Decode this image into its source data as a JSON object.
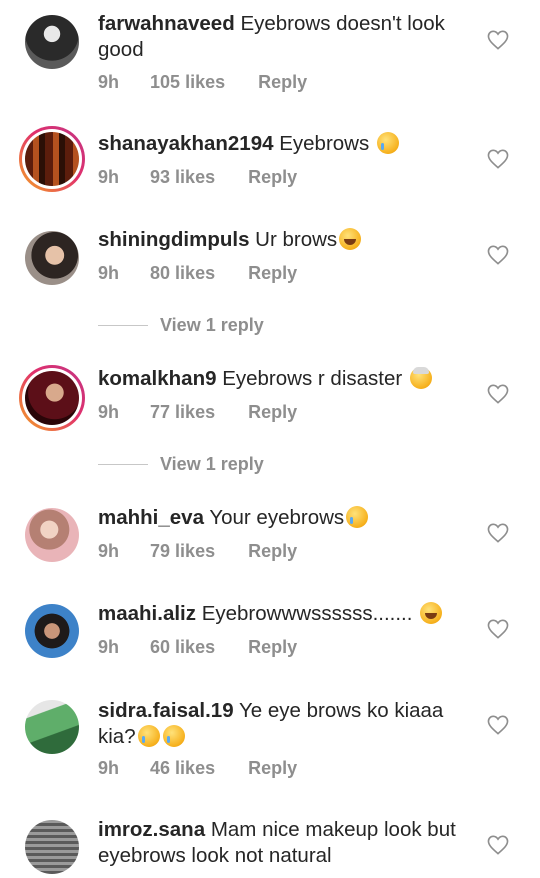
{
  "comments": [
    {
      "username": "farwahnaveed",
      "text": "Eyebrows doesn't look good",
      "time": "9h",
      "likes": "105 likes",
      "reply": "Reply",
      "avatar_color": "#4a4a4a"
    },
    {
      "username": "shanayakhan2194",
      "text": "Eyebrows",
      "emoji": "cry-face",
      "time": "9h",
      "likes": "93 likes",
      "reply": "Reply",
      "avatar_color": "#8a3a1c"
    },
    {
      "username": "shiningdimpuls",
      "text": "Ur brows",
      "emoji": "laughing-face",
      "time": "9h",
      "likes": "80 likes",
      "reply": "Reply",
      "avatar_color": "#6b5b52",
      "view_reply": "View 1 reply"
    },
    {
      "username": "komalkhan9",
      "text": "Eyebrows r disaster",
      "emoji": "exploding-head",
      "time": "9h",
      "likes": "77 likes",
      "reply": "Reply",
      "avatar_color": "#7a1420",
      "view_reply": "View 1 reply"
    },
    {
      "username": "mahhi_eva",
      "text": "Your eyebrows",
      "emoji": "cry-face",
      "time": "9h",
      "likes": "79 likes",
      "reply": "Reply",
      "avatar_color": "#d9a5a5"
    },
    {
      "username": "maahi.aliz",
      "text": "Eyebrowwwssssss.......",
      "emoji": "laughing-face",
      "time": "9h",
      "likes": "60 likes",
      "reply": "Reply",
      "avatar_color": "#3f7fc0"
    },
    {
      "username": "sidra.faisal.19",
      "text": "Ye eye brows ko kiaaa kia?",
      "emoji": "cry-face-x2",
      "time": "9h",
      "likes": "46 likes",
      "reply": "Reply",
      "avatar_color": "#4f8a5a"
    },
    {
      "username": "imroz.sana",
      "text": "Mam nice makeup look but eyebrows look not natural",
      "avatar_color": "#6b6b6b"
    }
  ],
  "colors": {
    "muted": "#8e8e8e",
    "text": "#262626",
    "ring_start": "#f5a623",
    "ring_end": "#c13584"
  }
}
